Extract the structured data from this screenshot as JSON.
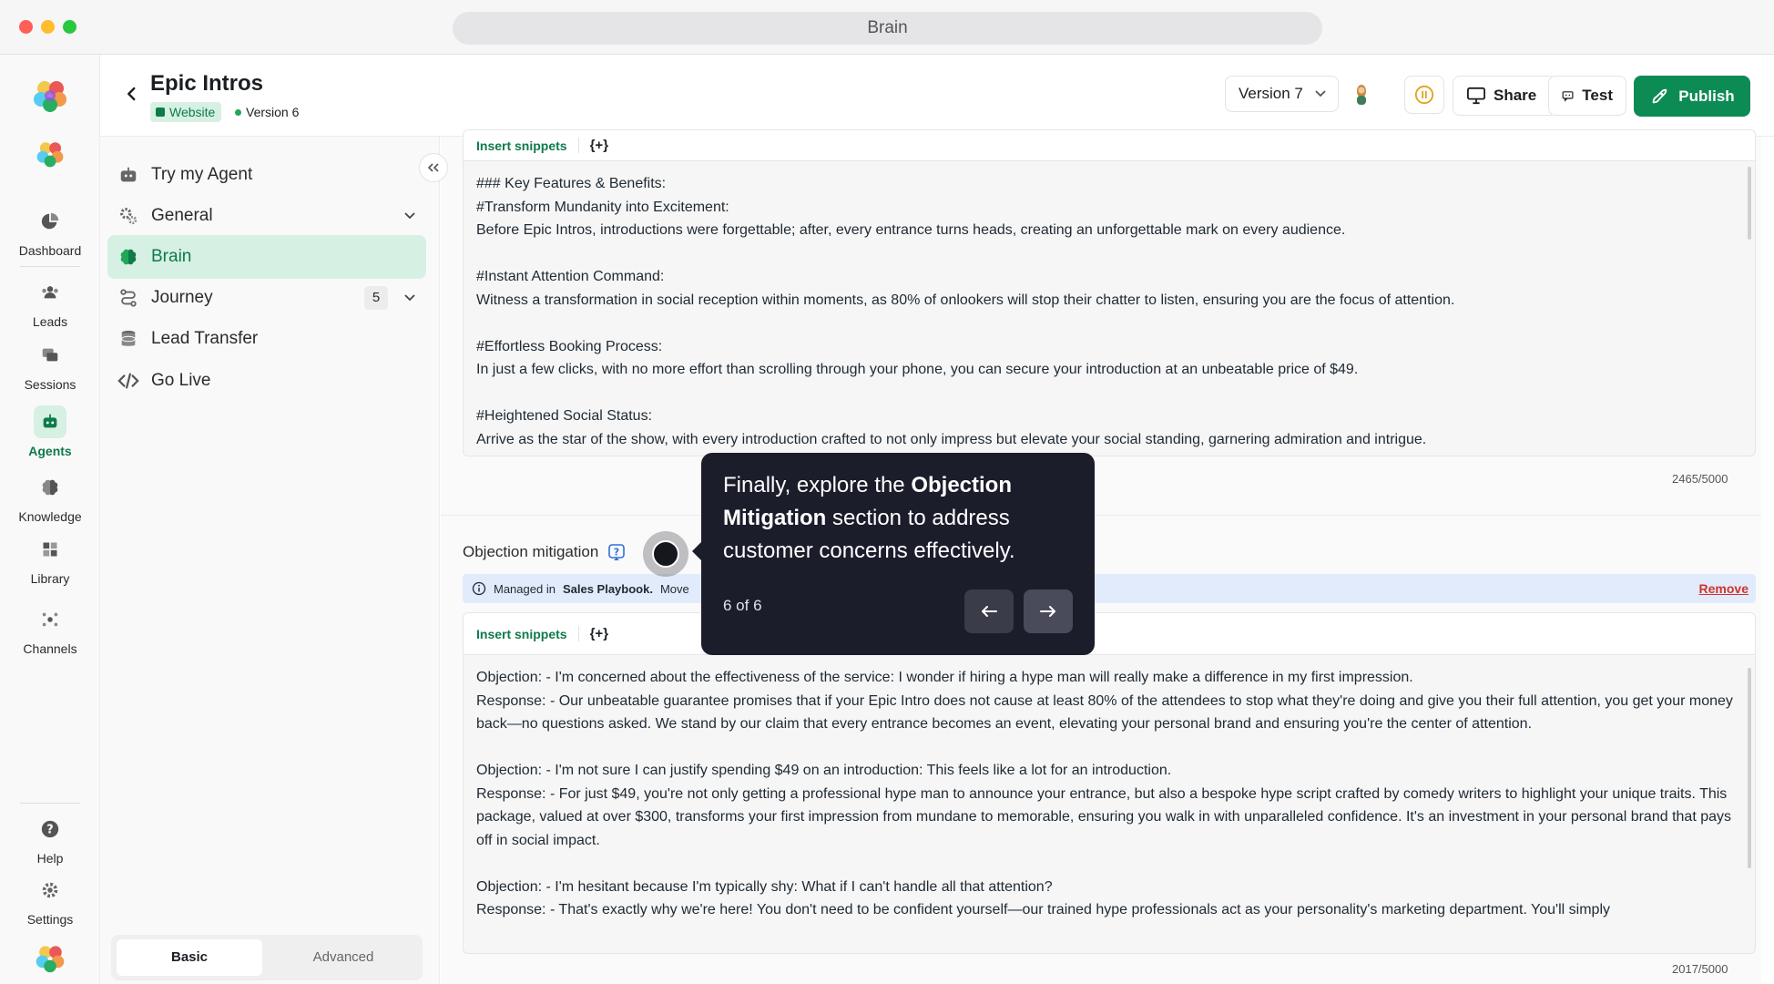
{
  "window": {
    "address": "Brain"
  },
  "rail": {
    "items": [
      {
        "label": "Dashboard",
        "icon": "pie-chart-icon"
      },
      {
        "label": "Leads",
        "icon": "people-icon"
      },
      {
        "label": "Sessions",
        "icon": "chat-bubbles-icon"
      },
      {
        "label": "Agents",
        "icon": "robot-icon",
        "active": true
      },
      {
        "label": "Knowledge",
        "icon": "brain-icon"
      },
      {
        "label": "Library",
        "icon": "grid-icon"
      },
      {
        "label": "Channels",
        "icon": "network-icon"
      },
      {
        "label": "Help",
        "icon": "help-icon"
      },
      {
        "label": "Settings",
        "icon": "gear-icon"
      }
    ]
  },
  "header": {
    "title": "Epic Intros",
    "channel_tag": "Website",
    "live_version": "Version 6",
    "version_select": "Version 7",
    "share_label": "Share",
    "test_label": "Test",
    "publish_label": "Publish"
  },
  "sidenav": {
    "items": [
      {
        "label": "Try my Agent"
      },
      {
        "label": "General"
      },
      {
        "label": "Brain"
      },
      {
        "label": "Journey",
        "badge": "5"
      },
      {
        "label": "Lead Transfer"
      },
      {
        "label": "Go Live"
      }
    ],
    "toggle": {
      "basic": "Basic",
      "advanced": "Advanced"
    }
  },
  "editor1": {
    "insert_snippets": "Insert snippets",
    "plus": "{+}",
    "text": "### Key Features & Benefits:\n#Transform Mundanity into Excitement:\nBefore Epic Intros, introductions were forgettable; after, every entrance turns heads, creating an unforgettable mark on every audience.\n\n#Instant Attention Command:\nWitness a transformation in social reception within moments, as 80% of onlookers will stop their chatter to listen, ensuring you are the focus of attention.\n\n#Effortless Booking Process:\nIn just a few clicks, with no more effort than scrolling through your phone, you can secure your introduction at an unbeatable price of $49.\n\n#Heightened Social Status:\nArrive as the star of the show, with every introduction crafted to not only impress but elevate your social standing, garnering admiration and intrigue.",
    "count": "2465/5000"
  },
  "objection": {
    "label": "Objection mitigation",
    "managed_prefix": "Managed in",
    "managed_source": "Sales Playbook.",
    "managed_suffix": "Move",
    "remove": "Remove"
  },
  "editor2": {
    "insert_snippets": "Insert snippets",
    "plus": "{+}",
    "text": "Objection: - I'm concerned about the effectiveness of the service: I wonder if hiring a hype man will really make a difference in my first impression.\nResponse: - Our unbeatable guarantee promises that if your Epic Intro does not cause at least 80% of the attendees to stop what they're doing and give you their full attention, you get your money back—no questions asked. We stand by our claim that every entrance becomes an event, elevating your personal brand and ensuring you're the center of attention.\n\nObjection: - I'm not sure I can justify spending $49 on an introduction: This feels like a lot for an introduction.\nResponse: - For just $49, you're not only getting a professional hype man to announce your entrance, but also a bespoke hype script crafted by comedy writers to highlight your unique traits. This package, valued at over $300, transforms your first impression from mundane to memorable, ensuring you walk in with unparalleled confidence. It's an investment in your personal brand that pays off in social impact.\n\nObjection: - I'm hesitant because I'm typically shy: What if I can't handle all that attention?\nResponse: - That's exactly why we're here! You don't need to be confident yourself—our trained hype professionals act as your personality's marketing department. You'll simply",
    "count": "2017/5000"
  },
  "tour": {
    "text_before": "Finally, explore the ",
    "text_bold": "Objection Mitigation",
    "text_after": " section to address customer concerns effectively.",
    "step": "6 of 6"
  },
  "colors": {
    "brand_green": "#0d8b55",
    "tour_bg": "#1c1d2b",
    "info_bar": "#e1ebfb",
    "danger": "#d0342c"
  }
}
